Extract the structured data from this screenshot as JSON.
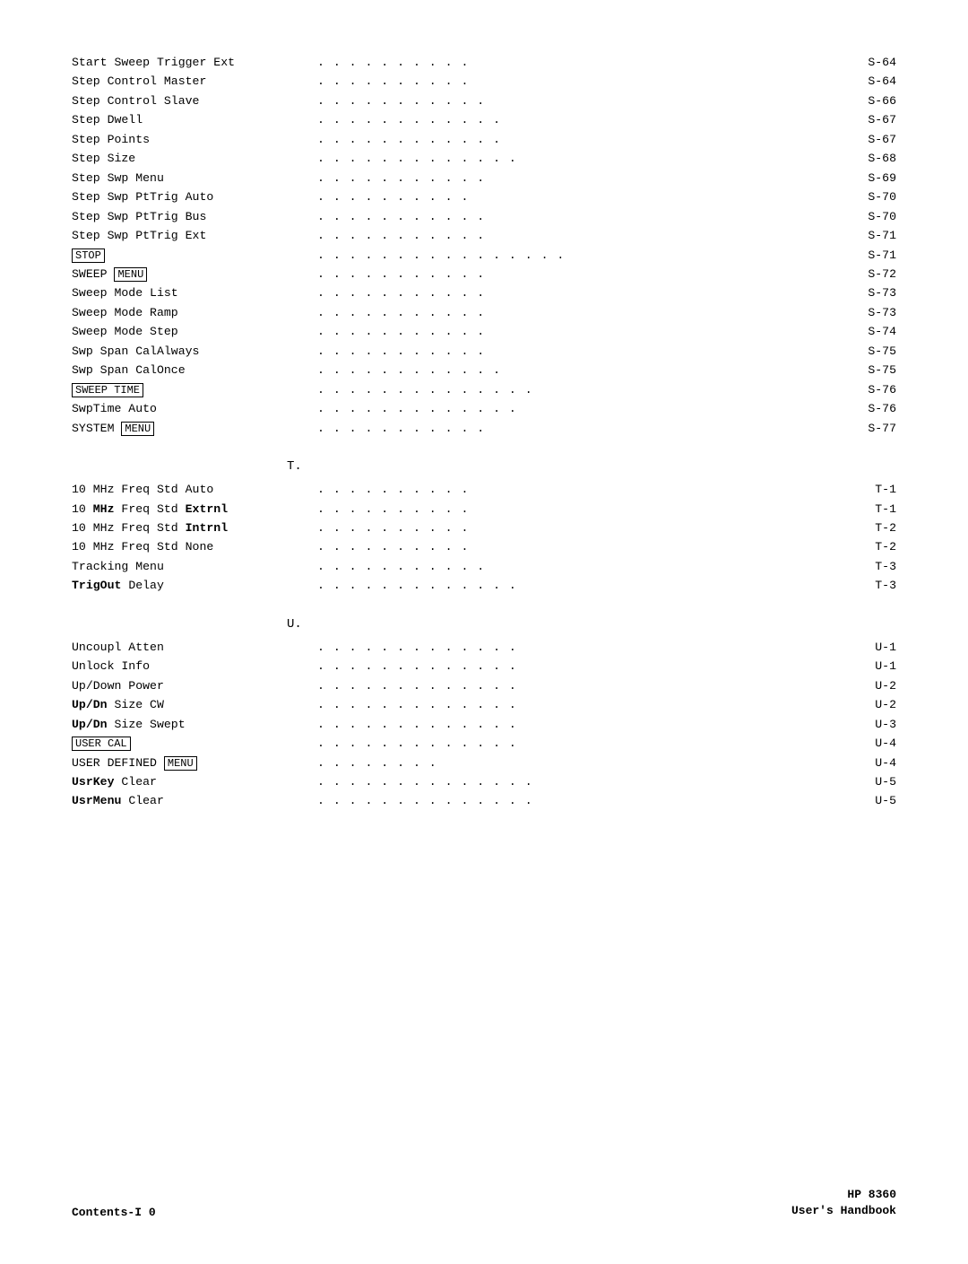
{
  "sections": {
    "s_section": {
      "entries": [
        {
          "label": "Start Sweep Trigger Ext",
          "dots": ". . . . . . . . . .",
          "page": "S-64",
          "bold": false,
          "boxed": null
        },
        {
          "label": "Step Control Master",
          "dots": ". . . . . . . . . .",
          "page": "S-64",
          "bold": false,
          "boxed": null
        },
        {
          "label": "Step Control Slave",
          "dots": ". . . . . . . . . .",
          "page": "S-66",
          "bold": false,
          "boxed": null
        },
        {
          "label": "Step Dwell",
          "dots": ". . . . . . . . . . . .",
          "page": "S-67",
          "bold": false,
          "boxed": null
        },
        {
          "label": "Step Points",
          "dots": ". . . . . . . . . . . .",
          "page": "S-67",
          "bold": false,
          "boxed": null
        },
        {
          "label": "Step Size",
          "dots": ". . . . . . . . . . . . .",
          "page": "S-68",
          "bold": false,
          "boxed": null
        },
        {
          "label": "Step Swp Menu",
          "dots": ". . . . . . . . . . .",
          "page": "S-69",
          "bold": false,
          "boxed": null
        },
        {
          "label": "Step Swp PtTrig Auto",
          "dots": ". . . . . . . . . .",
          "page": "S-70",
          "bold": false,
          "boxed": null
        },
        {
          "label": "Step Swp PtTrig Bus",
          "dots": ". . . . . . . . . . .",
          "page": "S-70",
          "bold": false,
          "boxed": null
        },
        {
          "label": "Step Swp PtTrig Ext",
          "dots": ". . . . . . . . . . .",
          "page": "S-71",
          "bold": false,
          "boxed": null
        },
        {
          "label": "STOP",
          "dots": ". . . . . . . . . . . . . . . .",
          "page": "S-71",
          "bold": false,
          "boxed": "STOP",
          "boxedPos": "label"
        },
        {
          "label": "SWEEP MENU",
          "dots": ". . . . . . . . . . .",
          "page": "S-72",
          "bold": false,
          "boxed": "MENU",
          "labelPrefix": "SWEEP "
        },
        {
          "label": "Sweep Mode List",
          "dots": ". . . . . . . . . . .",
          "page": "S-73",
          "bold": false,
          "boxed": null
        },
        {
          "label": "Sweep Mode Ramp",
          "dots": ". . . . . . . . . . .",
          "page": "S-73",
          "bold": false,
          "boxed": null
        },
        {
          "label": "Sweep Mode Step",
          "dots": ". . . . . . . . . . .",
          "page": "S-74",
          "bold": false,
          "boxed": null
        },
        {
          "label": "Swp Span CalAlways",
          "dots": ". . . . . . . . . . .",
          "page": "S-75",
          "bold": false,
          "boxed": null
        },
        {
          "label": "Swp Span CalOnce",
          "dots": ". . . . . . . . . . . .",
          "page": "S-75",
          "bold": false,
          "boxed": null
        },
        {
          "label": "SWEEP TIME",
          "dots": ". . . . . . . . . . . . . .",
          "page": "S-76",
          "bold": false,
          "boxed": "SWEEP TIME",
          "boxedPos": "label"
        },
        {
          "label": "SwpTime Auto",
          "dots": ". . . . . . . . . . . . .",
          "page": "S-76",
          "bold": false,
          "boxed": null
        },
        {
          "label": "SYSTEM MENU",
          "dots": ". . . . . . . . . . .",
          "page": "S-77",
          "bold": false,
          "boxed": "MENU",
          "labelPrefix": "SYSTEM "
        }
      ]
    },
    "t_section": {
      "letter": "T.",
      "entries": [
        {
          "label": "10 MHz Freq Std Auto",
          "dots": ". . . . . . . . . .",
          "page": "T-1"
        },
        {
          "label_html": "10 <b>MHz</b> Freq Std <b>Extrnl</b>",
          "label": "10 MHz Freq Std Extrnl",
          "dots": ". . . . . . . . . .",
          "page": "T-1",
          "bold_parts": [
            "MHz",
            "Extrnl"
          ]
        },
        {
          "label_html": "10 MHz Freq Std <b>Intrnl</b>",
          "label": "10 MHz Freq Std Intrnl",
          "dots": ". . . . . . . . . .",
          "page": "T-2",
          "bold_parts": [
            "Intrnl"
          ]
        },
        {
          "label": "10 MHz Freq Std None",
          "dots": ". . . . . . . . . .",
          "page": "T-2"
        },
        {
          "label": "Tracking Menu",
          "dots": ". . . . . . . . . . .",
          "page": "T-3"
        },
        {
          "label_html": "<b>TrigOut</b> Delay",
          "label": "TrigOut Delay",
          "dots": ". . . . . . . . . . . . .",
          "page": "T-3",
          "bold_parts": [
            "TrigOut"
          ]
        }
      ]
    },
    "u_section": {
      "letter": "U.",
      "entries": [
        {
          "label": "Uncoupl Atten",
          "dots": ". . . . . . . . . . . . .",
          "page": "U-1",
          "bold": false
        },
        {
          "label": "Unlock Info",
          "dots": ". . . . . . . . . . . . .",
          "page": "U-1",
          "bold": false
        },
        {
          "label": "Up/Down Power",
          "dots": ". . . . . . . . . . . . .",
          "page": "U-2",
          "bold": false
        },
        {
          "label_html": "<b>Up/Dn</b> Size CW",
          "label": "Up/Dn Size CW",
          "dots": ". . . . . . . . . . . . .",
          "page": "U-2",
          "bold_parts": [
            "Up/Dn"
          ]
        },
        {
          "label_html": "<b>Up/Dn</b> Size Swept",
          "label": "Up/Dn Size Swept",
          "dots": ". . . . . . . . . . . . .",
          "page": "U-3",
          "bold_parts": [
            "Up/Dn"
          ]
        },
        {
          "label": "USER CAL",
          "dots": ". . . . . . . . . . . . .",
          "page": "U-4",
          "boxed": "USER CAL",
          "boxedPos": "label"
        },
        {
          "label": "USER DEFINED MENU",
          "dots": ". . . . . . . .",
          "page": "U-4",
          "boxed": "MENU",
          "labelPrefix": "USER DEFINED "
        },
        {
          "label_html": "<b>UsrKey</b> Clear",
          "label": "UsrKey Clear",
          "dots": ". . . . . . . . . . . . . .",
          "page": "U-5",
          "bold_parts": [
            "UsrKey"
          ]
        },
        {
          "label_html": "<b>UsrMenu</b> Clear",
          "label": "UsrMenu Clear",
          "dots": ". . . . . . . . . . . . .",
          "page": "U-5",
          "bold_parts": [
            "UsrMenu"
          ]
        }
      ]
    }
  },
  "footer": {
    "left": "Contents-I 0",
    "right_line1": "HP 8360",
    "right_line2": "User's Handbook"
  }
}
